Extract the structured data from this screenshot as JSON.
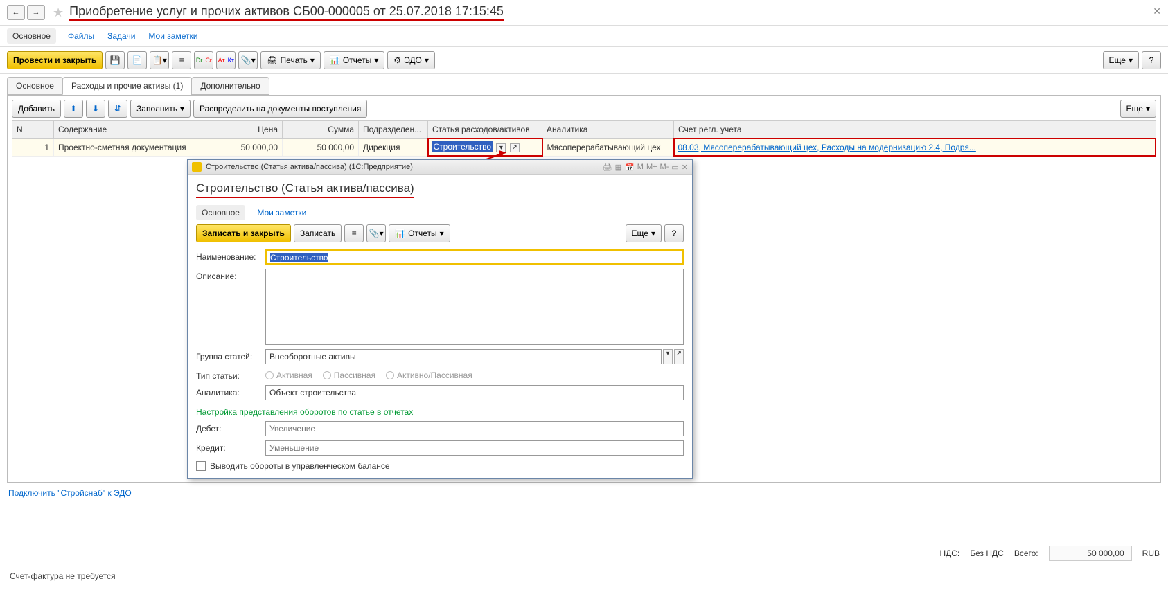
{
  "header": {
    "title": "Приобретение услуг и прочих активов СБ00-000005 от 25.07.2018 17:15:45"
  },
  "main_tabs": {
    "t0": "Основное",
    "t1": "Файлы",
    "t2": "Задачи",
    "t3": "Мои заметки"
  },
  "toolbar": {
    "post_close": "Провести и закрыть",
    "print": "Печать",
    "reports": "Отчеты",
    "edo": "ЭДО",
    "more": "Еще"
  },
  "sub_tabs": {
    "t0": "Основное",
    "t1": "Расходы и прочие активы (1)",
    "t2": "Дополнительно"
  },
  "inner_tb": {
    "add": "Добавить",
    "fill": "Заполнить",
    "distribute": "Распределить на документы поступления",
    "more": "Еще"
  },
  "table": {
    "headers": {
      "n": "N",
      "content": "Содержание",
      "price": "Цена",
      "sum": "Сумма",
      "dept": "Подразделен...",
      "expense": "Статья расходов/активов",
      "analytics": "Аналитика",
      "account": "Счет регл. учета"
    },
    "row": {
      "n": "1",
      "content": "Проектно-сметная документация",
      "price": "50 000,00",
      "sum": "50 000,00",
      "dept": "Дирекция",
      "expense": "Строительство",
      "analytics": "Мясоперерабатывающий цех",
      "account": "08.03, Мясоперерабатывающий цех, Расходы на модернизацию 2.4, Подря..."
    }
  },
  "footer": {
    "connect_edo": "Подключить \"Стройснаб\" к ЭДО",
    "nds_label": "НДС:",
    "nds_value": "Без НДС",
    "total_label": "Всего:",
    "total_value": "50 000,00",
    "currency": "RUB",
    "invoice_status": "Счет-фактура не требуется"
  },
  "popup": {
    "window_title": "Строительство (Статья актива/пассива)  (1С:Предприятие)",
    "heading": "Строительство (Статья актива/пассива)",
    "tabs": {
      "main": "Основное",
      "notes": "Мои заметки"
    },
    "toolbar": {
      "save_close": "Записать и закрыть",
      "save": "Записать",
      "reports": "Отчеты",
      "more": "Еще",
      "help": "?"
    },
    "labels": {
      "name": "Наименование:",
      "descr": "Описание:",
      "group": "Группа статей:",
      "type": "Тип статьи:",
      "analytics": "Аналитика:",
      "green": "Настройка представления оборотов по статье в отчетах",
      "debit": "Дебет:",
      "credit": "Кредит:",
      "checkbox": "Выводить обороты в управленческом балансе"
    },
    "values": {
      "name": "Строительство",
      "group": "Внеоборотные активы",
      "analytics": "Объект строительства"
    },
    "radio": {
      "active": "Активная",
      "passive": "Пассивная",
      "both": "Активно/Пассивная"
    },
    "placeholders": {
      "debit": "Увеличение",
      "credit": "Уменьшение"
    }
  }
}
